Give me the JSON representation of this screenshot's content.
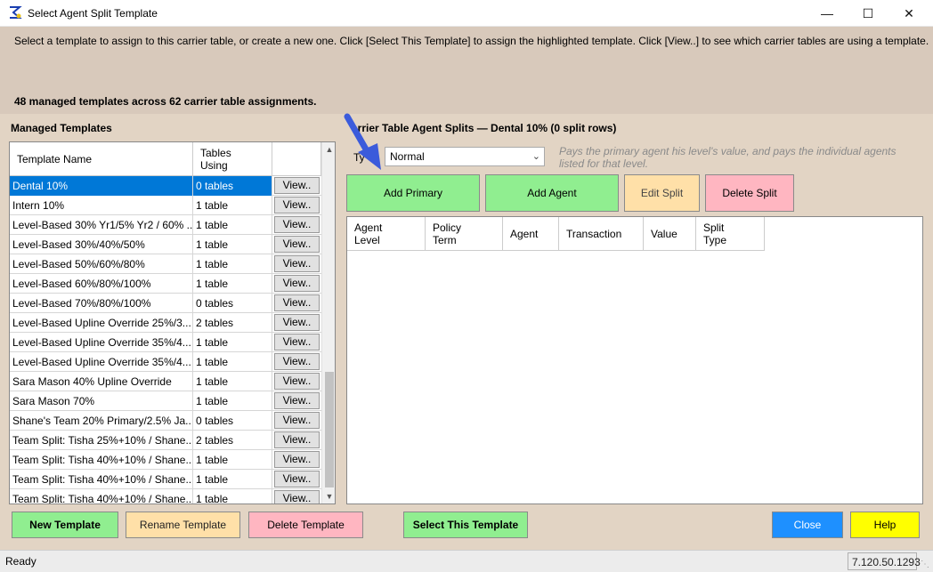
{
  "window": {
    "title": "Select Agent Split Template"
  },
  "header": {
    "instructions": "Select a template to assign to this carrier table, or create a new one. Click [Select This Template] to assign the highlighted template. Click [View..] to see which carrier tables are using a template.",
    "summary": "48 managed templates across 62 carrier table assignments."
  },
  "templates": {
    "section_label": "Managed Templates",
    "columns": {
      "name": "Template Name",
      "tables": "Tables\nUsing"
    },
    "view_label": "View..",
    "rows": [
      {
        "name": "Dental 10%",
        "tables": "0 tables",
        "selected": true
      },
      {
        "name": "Intern 10%",
        "tables": "1 table"
      },
      {
        "name": "Level-Based 30% Yr1/5% Yr2 / 60% ...",
        "tables": "1 table"
      },
      {
        "name": "Level-Based 30%/40%/50%",
        "tables": "1 table"
      },
      {
        "name": "Level-Based 50%/60%/80%",
        "tables": "1 table"
      },
      {
        "name": "Level-Based 60%/80%/100%",
        "tables": "1 table"
      },
      {
        "name": "Level-Based 70%/80%/100%",
        "tables": "0 tables"
      },
      {
        "name": "Level-Based Upline Override 25%/3...",
        "tables": "2 tables"
      },
      {
        "name": "Level-Based Upline Override 35%/4...",
        "tables": "1 table"
      },
      {
        "name": "Level-Based Upline Override 35%/4...",
        "tables": "1 table"
      },
      {
        "name": "Sara Mason 40% Upline Override",
        "tables": "1 table"
      },
      {
        "name": "Sara Mason 70%",
        "tables": "1 table"
      },
      {
        "name": "Shane's Team 20% Primary/2.5% Ja...",
        "tables": "0 tables"
      },
      {
        "name": "Team Split: Tisha 25%+10% / Shane...",
        "tables": "2 tables"
      },
      {
        "name": "Team Split: Tisha 40%+10% / Shane...",
        "tables": "1 table"
      },
      {
        "name": "Team Split: Tisha 40%+10% / Shane...",
        "tables": "1 table"
      },
      {
        "name": "Team Split: Tisha 40%+10% / Shane...",
        "tables": "1 table"
      }
    ]
  },
  "splits": {
    "section_label": "arrier Table Agent Splits — Dental 10%  (0 split rows)",
    "type_label": "Ty",
    "type_value": "Normal",
    "type_description": "Pays the primary agent his level's value, and pays the individual agents listed for that level.",
    "buttons": {
      "add_primary": "Add Primary",
      "add_agent": "Add Agent",
      "edit_split": "Edit Split",
      "delete_split": "Delete Split"
    },
    "columns": {
      "agent_level": "Agent\nLevel",
      "policy_term": "Policy\nTerm",
      "agent": "Agent",
      "transaction": "Transaction",
      "value": "Value",
      "split_type": "Split\nType"
    }
  },
  "footer": {
    "new_template": "New Template",
    "rename_template": "Rename Template",
    "delete_template": "Delete Template",
    "select_template": "Select This Template",
    "close": "Close",
    "help": "Help"
  },
  "status": {
    "text": "Ready",
    "version": "7.120.50.1293"
  },
  "colors": {
    "background": "#e2d4c4",
    "header_panel": "#d8c9bb",
    "green": "#90ee90",
    "peach": "#ffe0a8",
    "pink": "#ffb6c1",
    "blue": "#1e90ff",
    "yellow": "#ffff00",
    "selection": "#0078d7",
    "annotation_arrow": "#3b5bdb"
  }
}
